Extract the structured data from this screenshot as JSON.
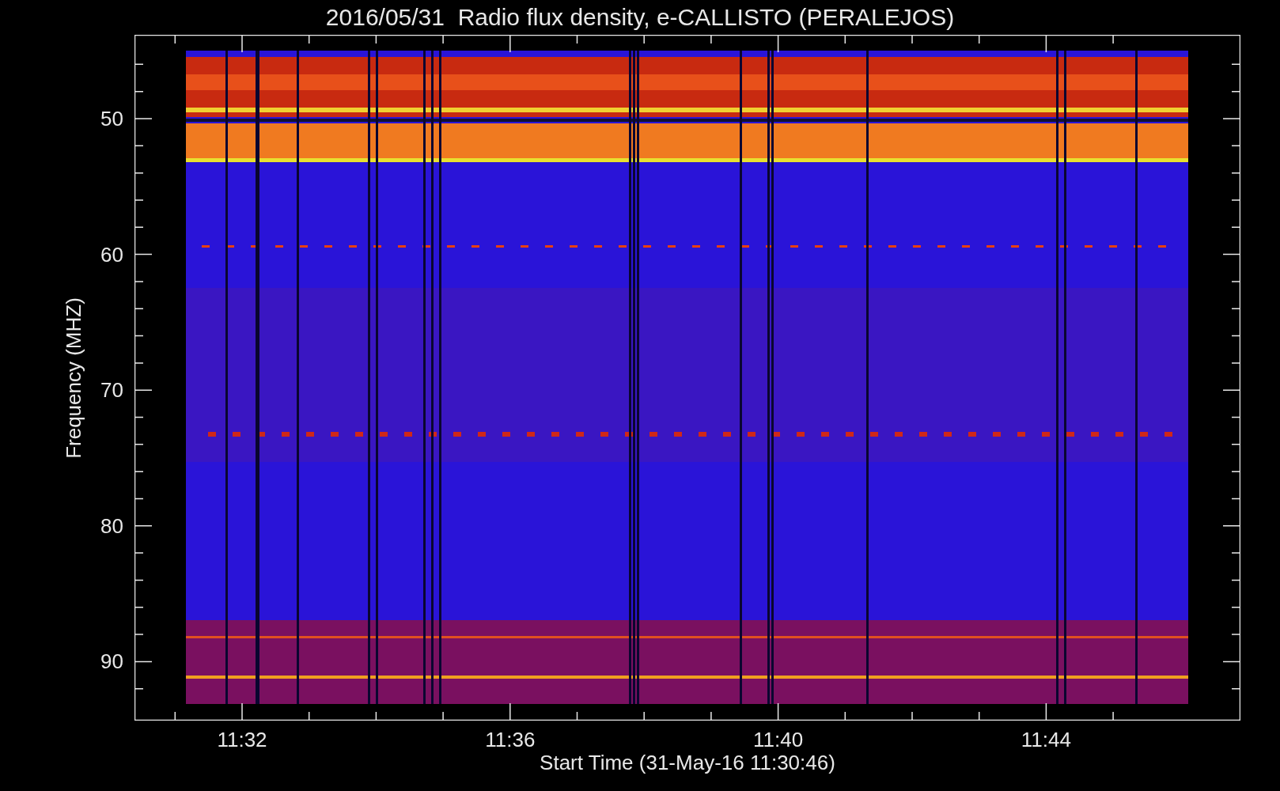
{
  "title": "2016/05/31  Radio flux density, e-CALLISTO (PERALEJOS)",
  "ylabel": "Frequency (MHZ)",
  "xlabel": "Start Time (31-May-16 11:30:46)",
  "yticks": [
    {
      "label": "50"
    },
    {
      "label": "60"
    },
    {
      "label": "70"
    },
    {
      "label": "80"
    },
    {
      "label": "90"
    }
  ],
  "xticks": [
    {
      "label": "11:32"
    },
    {
      "label": "11:36"
    },
    {
      "label": "11:40"
    },
    {
      "label": "11:44"
    }
  ]
}
